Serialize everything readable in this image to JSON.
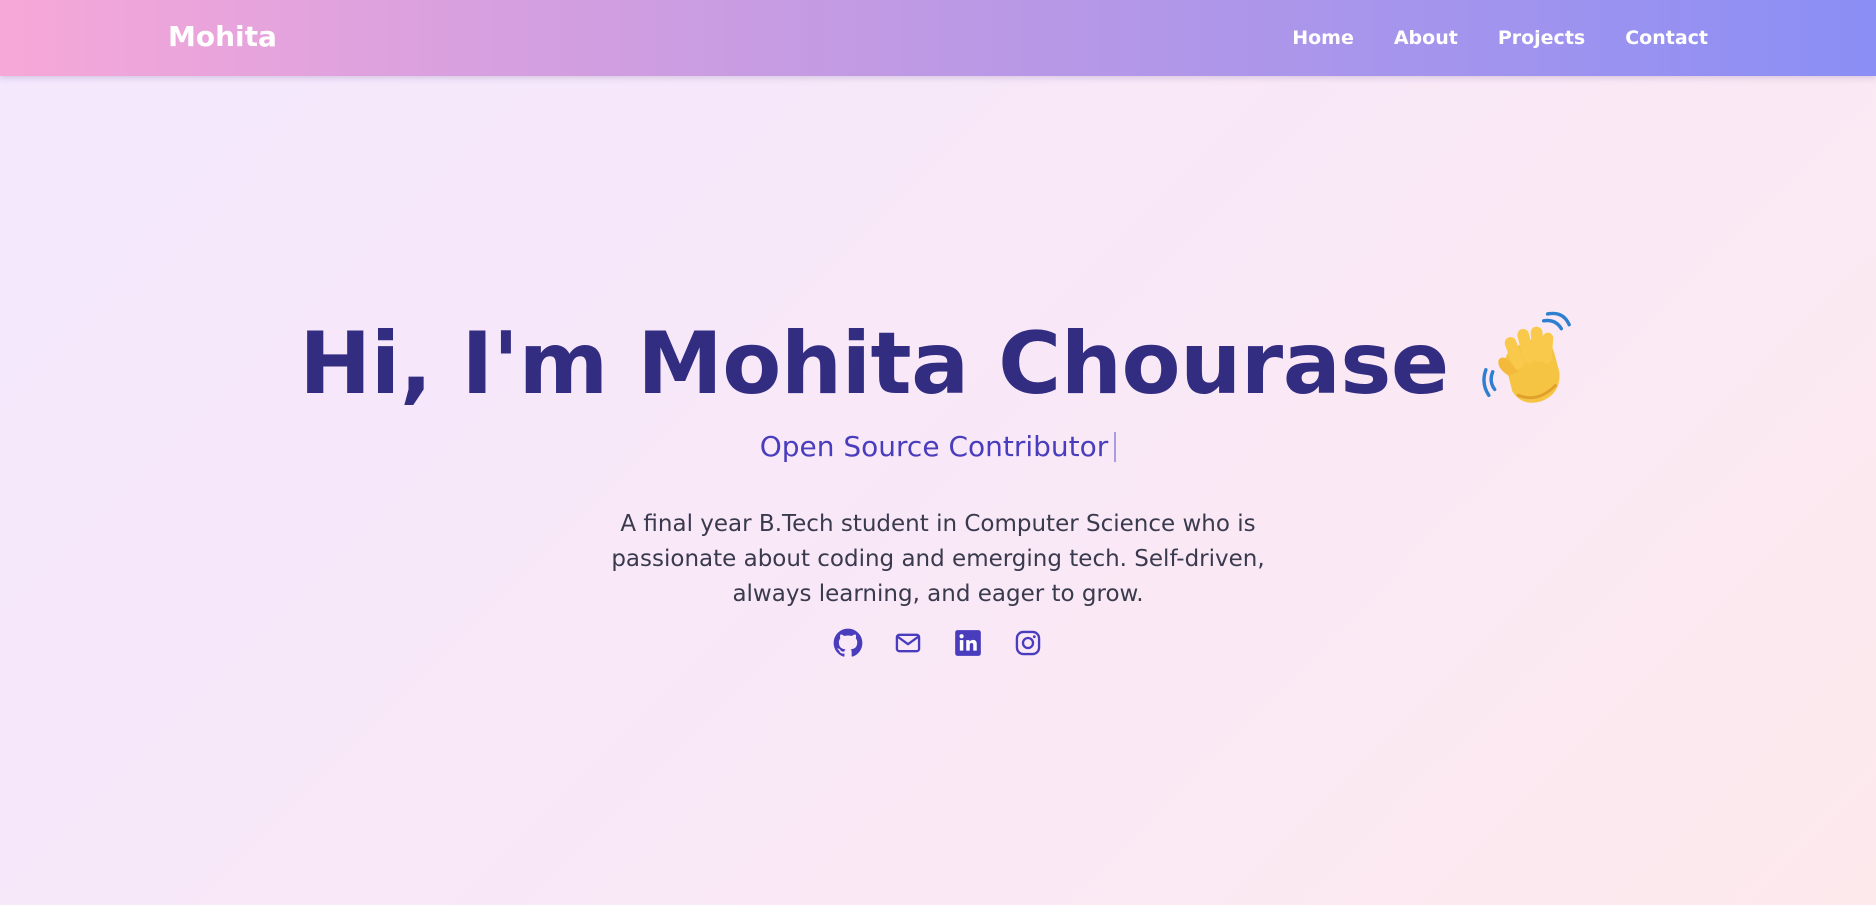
{
  "navbar": {
    "brand": "Mohita",
    "links": [
      "Home",
      "About",
      "Projects",
      "Contact"
    ]
  },
  "hero": {
    "title": "Hi, I'm Mohita Chourase",
    "title_emoji_icon": "waving-hand-icon",
    "role": "Open Source Contributor",
    "bio": "A final year B.Tech student in Computer Science who is passionate about coding and emerging tech. Self-driven, always learning, and eager to grow."
  },
  "socials": [
    {
      "icon": "github-icon"
    },
    {
      "icon": "mail-icon"
    },
    {
      "icon": "linkedin-icon"
    },
    {
      "icon": "instagram-icon"
    }
  ],
  "colors": {
    "title": "#332d82",
    "accent": "#4a3dbd",
    "bio_text": "#3a3a4e",
    "nav_gradient_start": "#f7a8d8",
    "nav_gradient_end": "#8a8ef5"
  }
}
